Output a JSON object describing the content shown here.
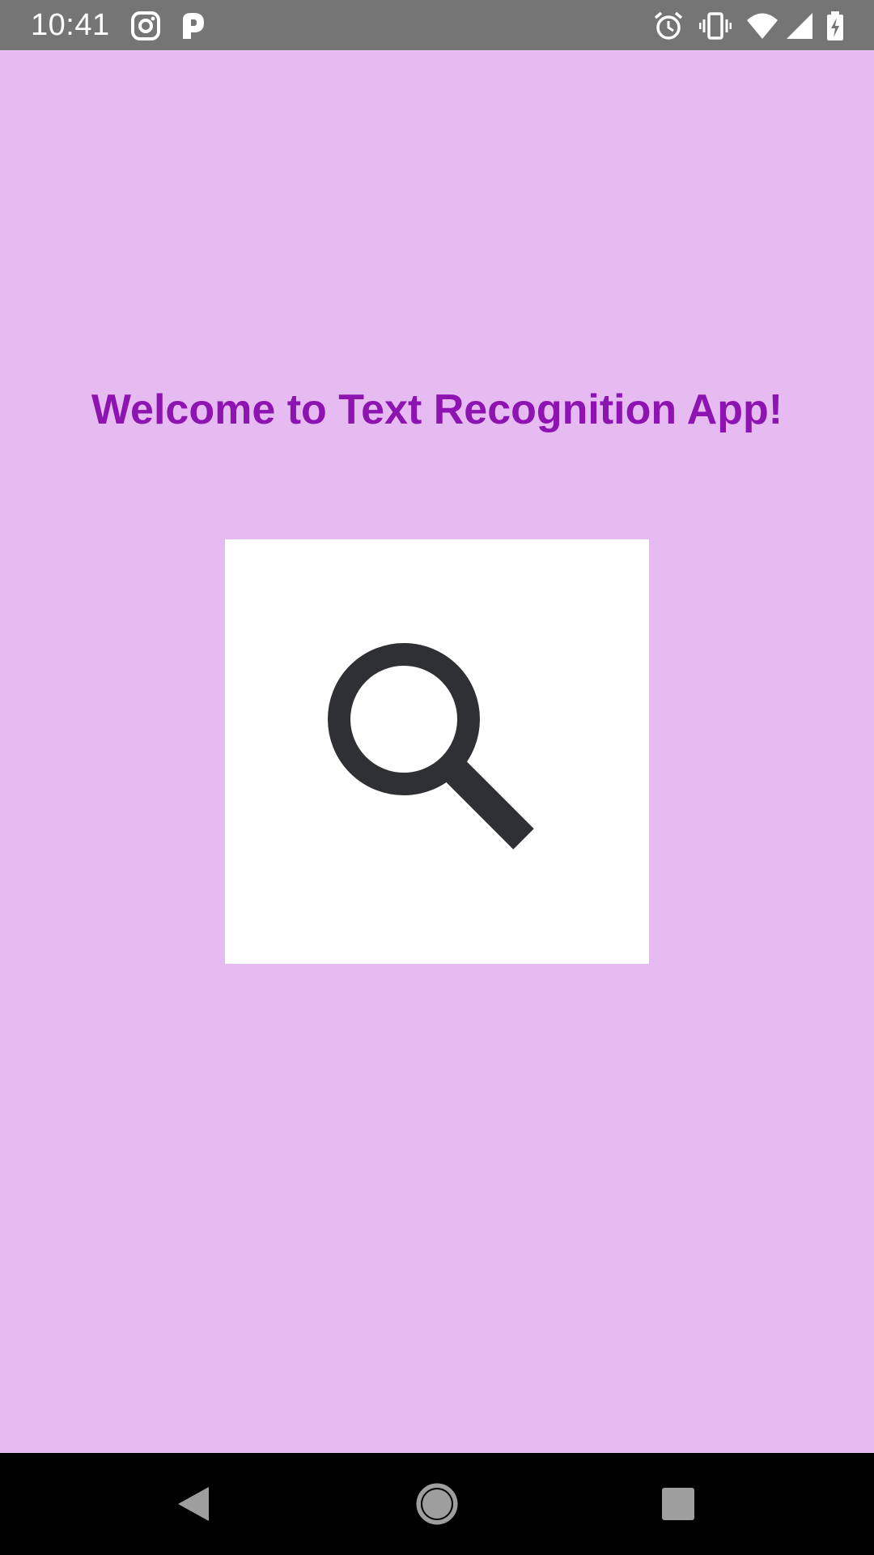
{
  "status_bar": {
    "time": "10:41",
    "left_icons": [
      "instagram-icon",
      "p-app-icon"
    ],
    "right_icons": [
      "alarm-icon",
      "vibrate-icon",
      "wifi-icon",
      "signal-icon",
      "battery-charging-icon"
    ],
    "background": "#757575"
  },
  "main": {
    "title": "Welcome to Text Recognition App!",
    "title_color": "#8E14B2",
    "background": "#E6BBF2",
    "scan_button_icon": "search-icon"
  },
  "nav_bar": {
    "buttons": [
      "back-icon",
      "home-icon",
      "recents-icon"
    ]
  }
}
